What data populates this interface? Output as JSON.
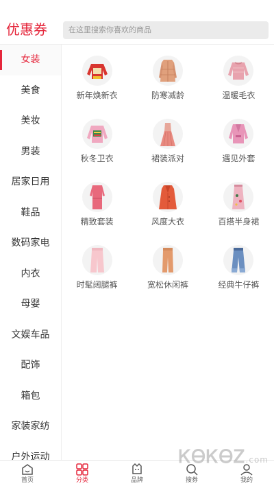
{
  "header": {
    "brand": "优惠券",
    "search_placeholder": "在这里搜索你喜欢的商品"
  },
  "colors": {
    "accent": "#e5263b",
    "tab_bg": "#ffffff",
    "thumb_bg": "#f3f3f3"
  },
  "sidebar": {
    "items": [
      {
        "label": "女装",
        "active": true
      },
      {
        "label": "美食"
      },
      {
        "label": "美妆"
      },
      {
        "label": "男装"
      },
      {
        "label": "居家日用"
      },
      {
        "label": "鞋品"
      },
      {
        "label": "数码家电"
      },
      {
        "label": "内衣"
      },
      {
        "label": "母婴"
      },
      {
        "label": "文娱车品"
      },
      {
        "label": "配饰"
      },
      {
        "label": "箱包"
      },
      {
        "label": "家装家纺"
      },
      {
        "label": "户外运动"
      }
    ]
  },
  "categories": [
    {
      "label": "新年焕新衣",
      "icon": "red-sweater-icon"
    },
    {
      "label": "防寒减龄",
      "icon": "puffer-coat-icon"
    },
    {
      "label": "温暖毛衣",
      "icon": "pink-sweater-icon"
    },
    {
      "label": "秋冬卫衣",
      "icon": "sweatshirt-icon"
    },
    {
      "label": "裙装派对",
      "icon": "pleated-dress-icon"
    },
    {
      "label": "遇见外套",
      "icon": "pink-jacket-icon"
    },
    {
      "label": "精致套装",
      "icon": "pink-set-icon"
    },
    {
      "label": "风度大衣",
      "icon": "red-coat-icon"
    },
    {
      "label": "百搭半身裙",
      "icon": "midi-skirt-icon"
    },
    {
      "label": "时髦阔腿裤",
      "icon": "wide-pants-icon"
    },
    {
      "label": "宽松休闲裤",
      "icon": "casual-pants-icon"
    },
    {
      "label": "经典牛仔裤",
      "icon": "jeans-icon"
    }
  ],
  "tabbar": {
    "items": [
      {
        "label": "首页",
        "icon": "home-icon"
      },
      {
        "label": "分类",
        "icon": "category-icon",
        "active": true
      },
      {
        "label": "品牌",
        "icon": "brand-icon"
      },
      {
        "label": "搜券",
        "icon": "coupon-search-icon"
      },
      {
        "label": "我的",
        "icon": "profile-icon"
      }
    ]
  },
  "watermark": {
    "text": "ᏦᎾᏦᎾᏃ",
    "suffix": ".com"
  }
}
